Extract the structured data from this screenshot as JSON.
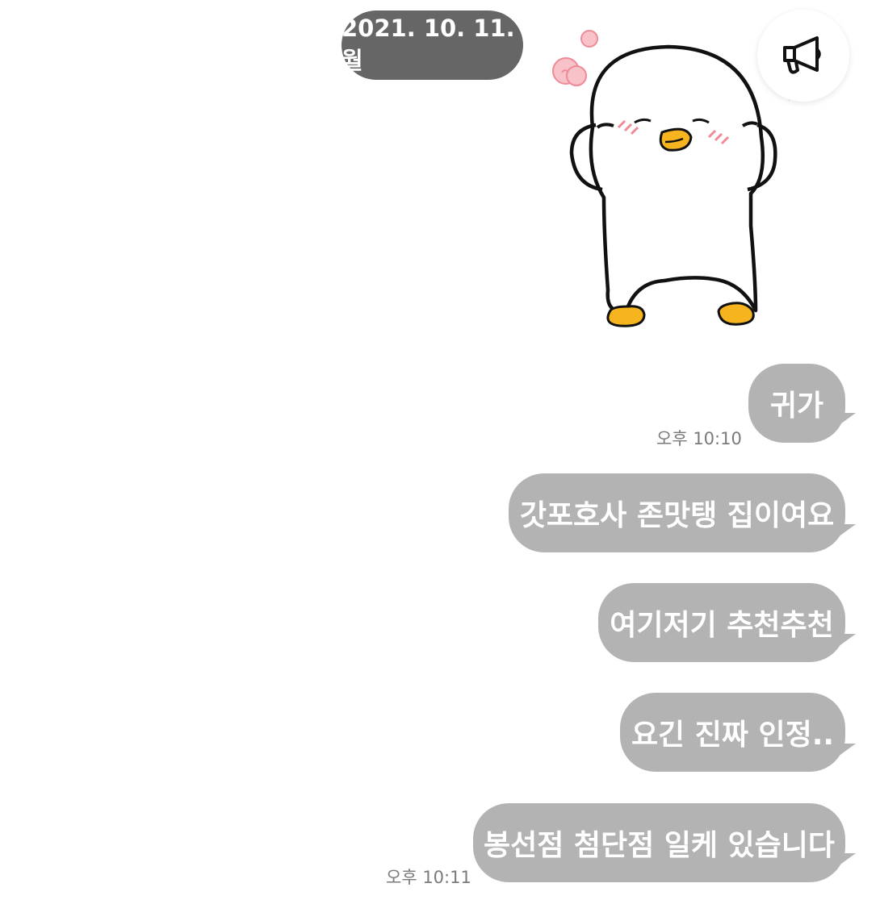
{
  "date_divider": "2021. 10. 11. 월",
  "announce_icon": "megaphone-icon",
  "sticker": {
    "icon": "penguin-blush-sticker"
  },
  "messages": [
    {
      "text": "귀가"
    },
    {
      "text": "갓포호사 존맛탱 집이여요"
    },
    {
      "text": "여기저기 추천추천"
    },
    {
      "text": "요긴 진짜 인정.."
    },
    {
      "text": "봉선점 첨단점 일케 있습니다"
    }
  ],
  "timestamps": {
    "first": "오후 10:10",
    "last": "오후 10:11"
  },
  "colors": {
    "bubble": "#b3b3b3",
    "date_pill": "#666666",
    "bubble_text": "#ffffff",
    "timestamp": "#7a7a7a"
  }
}
